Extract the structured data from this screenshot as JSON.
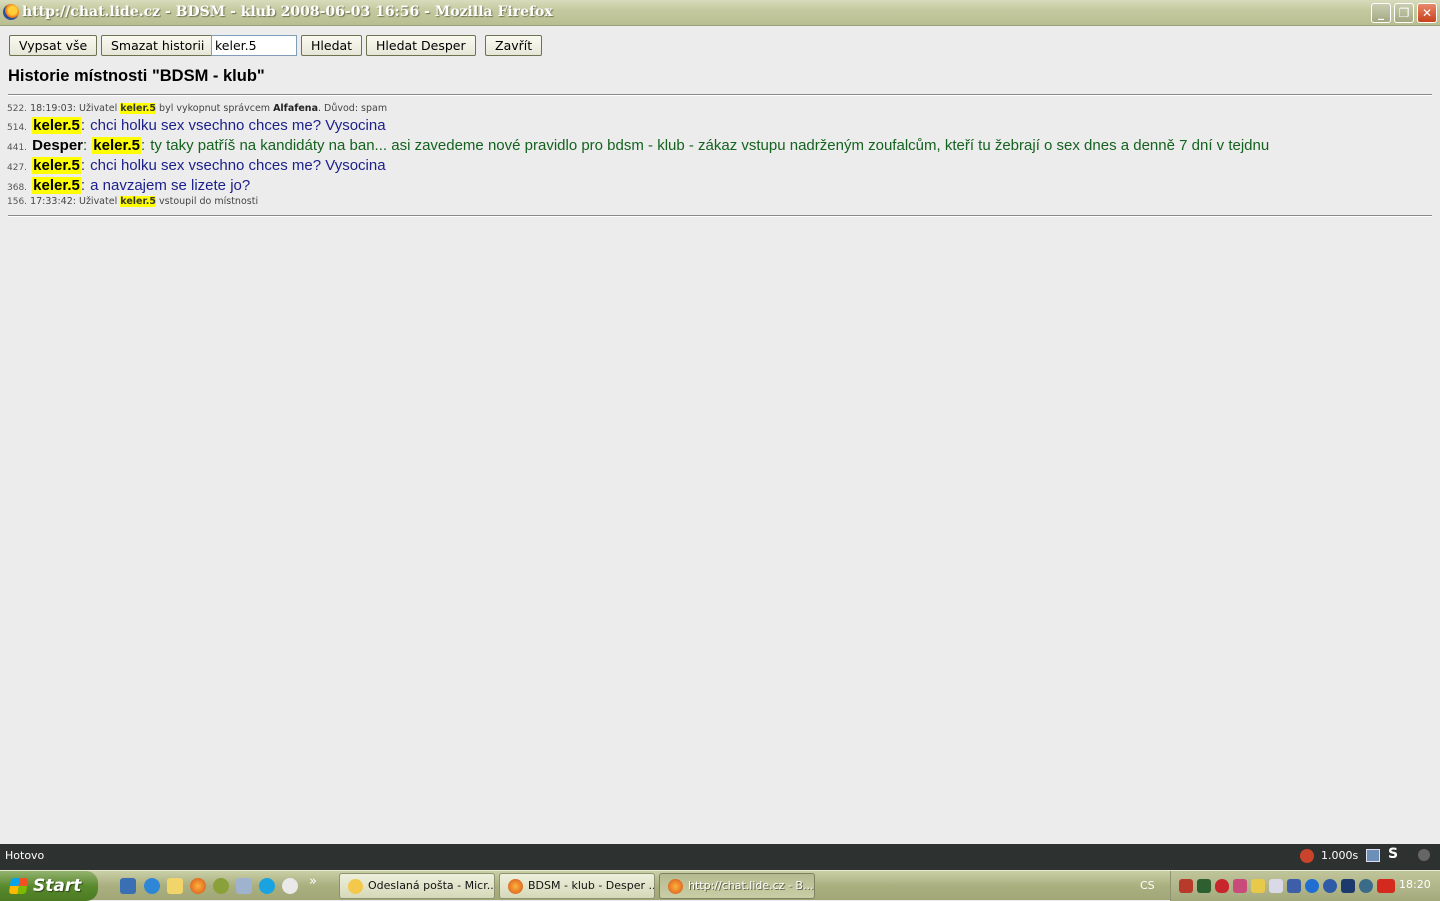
{
  "window": {
    "title": "http://chat.lide.cz - BDSM - klub 2008-06-03 16:56 - Mozilla Firefox",
    "minimize": "_",
    "restore": "❐",
    "close": "✕"
  },
  "toolbar": {
    "list_all": "Vypsat vše",
    "clear_history": "Smazat historii",
    "search_value": "keler.5",
    "search": "Hledat",
    "search_desper": "Hledat Desper",
    "close": "Zavřít"
  },
  "heading": "Historie místnosti \"BDSM - klub\"",
  "history": [
    {
      "num": "522.",
      "time": "18:19:03:",
      "pre": "Uživatel",
      "user": "keler.5",
      "mid": "byl vykopnut správcem",
      "admin": "Alfafena",
      "post": ". Důvod: spam"
    },
    {
      "num": "514.",
      "nick": "keler.5",
      "sep": ":",
      "text": "chci holku sex vsechno chces me? Vysocina"
    },
    {
      "num": "441.",
      "nick": "Desper",
      "sep": ":",
      "to": "keler.5",
      "text": "ty taky patříš na kandidáty na ban... asi zavedeme nové pravidlo pro bdsm - klub - zákaz vstupu nadrženým zoufalcům, kteří tu žebrají o sex dnes a denně 7 dní v tejdnu"
    },
    {
      "num": "427.",
      "nick": "keler.5",
      "sep": ":",
      "text": "chci holku sex vsechno chces me? Vysocina"
    },
    {
      "num": "368.",
      "nick": "keler.5",
      "sep": ":",
      "text": "a navzajem se lizete jo?"
    },
    {
      "num": "156.",
      "time": "17:33:42:",
      "pre": "Uživatel",
      "user": "keler.5",
      "post": "vstoupil do místnosti"
    }
  ],
  "statusbar": {
    "text": "Hotovo",
    "timing": "1.000s",
    "s_label": "S"
  },
  "taskbar": {
    "start": "Start",
    "chevron": "»",
    "tasks": [
      {
        "label": "Odeslaná pošta - Micr..."
      },
      {
        "label": "BDSM - klub - Desper ..."
      },
      {
        "label": "http://chat.lide.cz - B..."
      }
    ],
    "lang": "CS",
    "clock": "18:20"
  },
  "colors": {
    "highlight": "#ffff00",
    "message_blue": "#1b1f8a",
    "message_green": "#14621f"
  }
}
